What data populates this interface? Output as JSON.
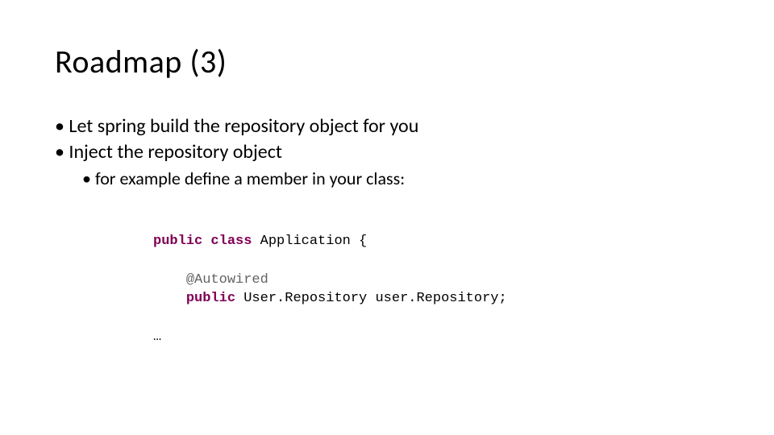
{
  "title": "Roadmap (3)",
  "bullets": {
    "items": [
      "Let spring build the repository object for you",
      "Inject the repository object"
    ],
    "subitems": [
      "for example define a member in your class:"
    ]
  },
  "code": {
    "kw_public1": "public",
    "kw_class": "class",
    "class_name": "Application {",
    "annotation": "@Autowired",
    "kw_public2": "public",
    "type": "User.Repository ",
    "field": "user.Repository",
    "semi": ";",
    "ellipsis": "…"
  },
  "glyphs": {
    "bullet": "•"
  }
}
